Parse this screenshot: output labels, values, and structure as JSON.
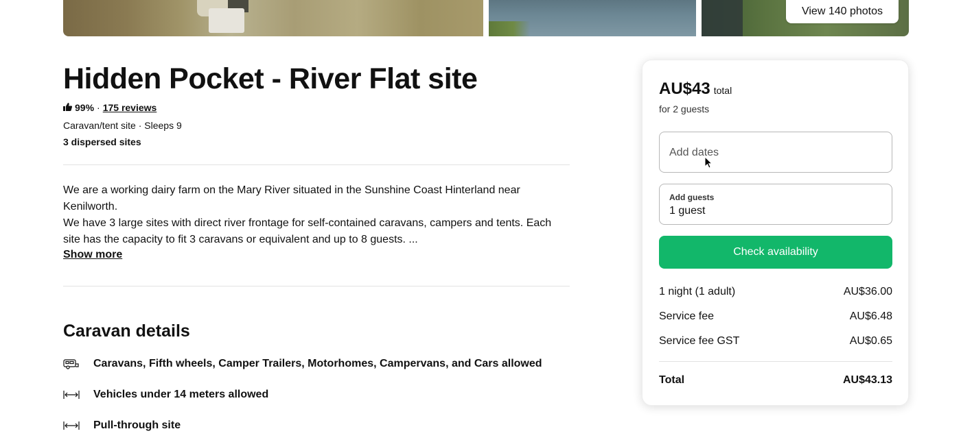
{
  "photos": {
    "view_all_label": "View 140 photos"
  },
  "listing": {
    "title": "Hidden Pocket - River Flat site",
    "rating_pct": "99%",
    "separator": "·",
    "reviews_label": "175 reviews",
    "type_line": "Caravan/tent site · Sleeps 9",
    "sites_line": "3 dispersed sites",
    "description_p1": "We are a working dairy farm on the Mary River situated in the Sunshine Coast Hinterland near Kenilworth.",
    "description_p2": "We have 3 large sites with direct river frontage for self-contained caravans, campers and tents. Each site has the capacity to fit 3 caravans or equivalent and up to 8 guests. ...",
    "show_more_label": "Show more"
  },
  "caravan_details": {
    "title": "Caravan details",
    "items": [
      {
        "icon": "caravan-icon",
        "text": "Caravans, Fifth wheels, Camper Trailers, Motorhomes, Campervans, and Cars allowed"
      },
      {
        "icon": "length-arrows-icon",
        "text": "Vehicles under 14 meters allowed"
      },
      {
        "icon": "length-arrows-icon",
        "text": "Pull-through site"
      }
    ]
  },
  "booking": {
    "price": "AU$43",
    "price_suffix": "total",
    "guests_note": "for 2 guests",
    "dates_placeholder": "Add dates",
    "guests_label": "Add guests",
    "guests_value": "1 guest",
    "check_button": "Check availability",
    "lines": [
      {
        "label": "1 night (1 adult)",
        "value": "AU$36.00"
      },
      {
        "label": "Service fee",
        "value": "AU$6.48"
      },
      {
        "label": "Service fee GST",
        "value": "AU$0.65"
      }
    ],
    "total_label": "Total",
    "total_value": "AU$43.13"
  },
  "colors": {
    "accent": "#12b76a",
    "text": "#111111",
    "divider": "#e2e2e2"
  }
}
